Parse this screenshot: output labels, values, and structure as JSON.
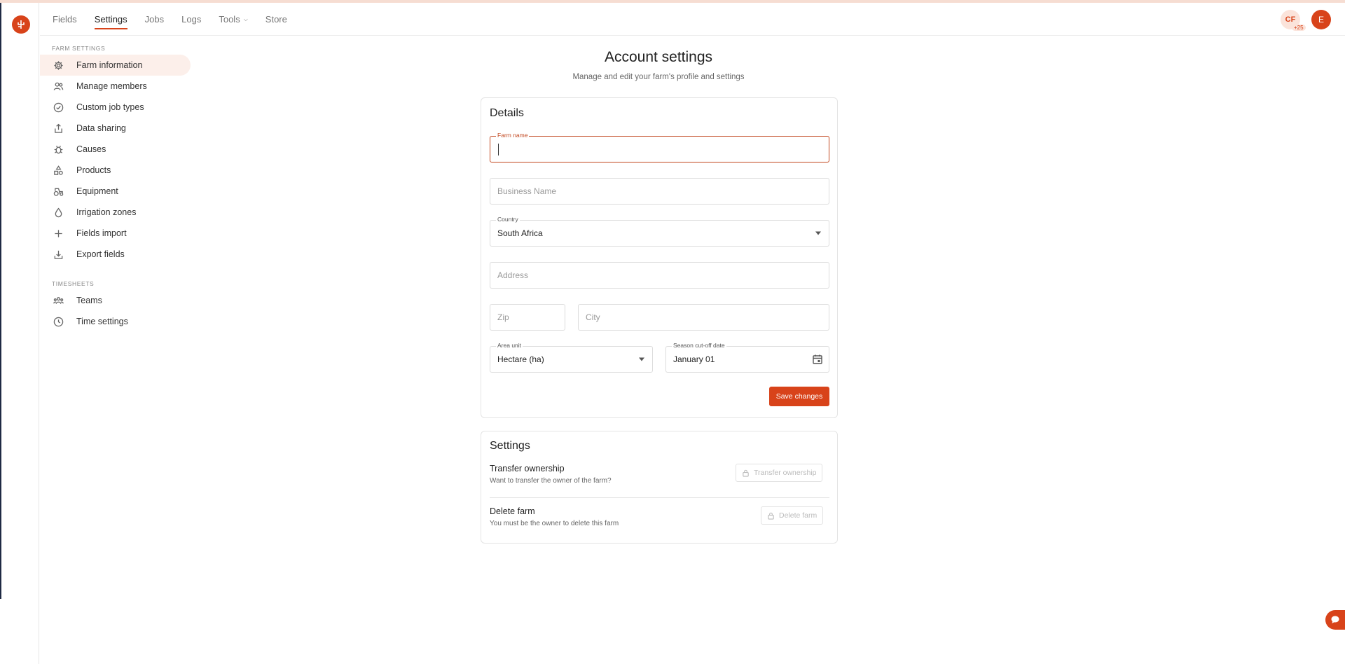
{
  "nav": {
    "items": [
      {
        "label": "Fields",
        "active": false
      },
      {
        "label": "Settings",
        "active": true
      },
      {
        "label": "Jobs",
        "active": false
      },
      {
        "label": "Logs",
        "active": false
      },
      {
        "label": "Tools",
        "active": false,
        "has_dropdown": true
      },
      {
        "label": "Store",
        "active": false
      }
    ]
  },
  "header": {
    "avatar_initials": "CF",
    "avatar_count": "+25",
    "user_initial": "E"
  },
  "sidebar": {
    "farm_section_label": "FARM SETTINGS",
    "farm_items": [
      {
        "label": "Farm information",
        "icon": "gear-icon",
        "active": true
      },
      {
        "label": "Manage members",
        "icon": "users-icon",
        "active": false
      },
      {
        "label": "Custom job types",
        "icon": "check-circle-icon",
        "active": false
      },
      {
        "label": "Data sharing",
        "icon": "share-icon",
        "active": false
      },
      {
        "label": "Causes",
        "icon": "bug-icon",
        "active": false
      },
      {
        "label": "Products",
        "icon": "products-icon",
        "active": false
      },
      {
        "label": "Equipment",
        "icon": "tractor-icon",
        "active": false
      },
      {
        "label": "Irrigation zones",
        "icon": "drop-icon",
        "active": false
      },
      {
        "label": "Fields import",
        "icon": "plus-icon",
        "active": false
      },
      {
        "label": "Export fields",
        "icon": "download-icon",
        "active": false
      }
    ],
    "timesheets_section_label": "TIMESHEETS",
    "timesheet_items": [
      {
        "label": "Teams",
        "icon": "team-icon",
        "active": false
      },
      {
        "label": "Time settings",
        "icon": "clock-icon",
        "active": false
      }
    ]
  },
  "main": {
    "title": "Account settings",
    "subtitle": "Manage and edit your farm's profile and settings",
    "details": {
      "title": "Details",
      "farm_name_label": "Farm name",
      "farm_name_value": "",
      "business_name_placeholder": "Business Name",
      "country_label": "Country",
      "country_value": "South Africa",
      "address_placeholder": "Address",
      "zip_placeholder": "Zip",
      "city_placeholder": "City",
      "area_unit_label": "Area unit",
      "area_unit_value": "Hectare (ha)",
      "season_label": "Season cut-off date",
      "season_value": "January 01",
      "save_label": "Save changes"
    },
    "settings": {
      "title": "Settings",
      "transfer_title": "Transfer ownership",
      "transfer_sub": "Want to transfer the owner of the farm?",
      "transfer_button": "Transfer ownership",
      "delete_title": "Delete farm",
      "delete_sub": "You must be the owner to delete this farm",
      "delete_button": "Delete farm"
    }
  },
  "colors": {
    "accent": "#d8431a",
    "active_bg": "#fcefea"
  }
}
